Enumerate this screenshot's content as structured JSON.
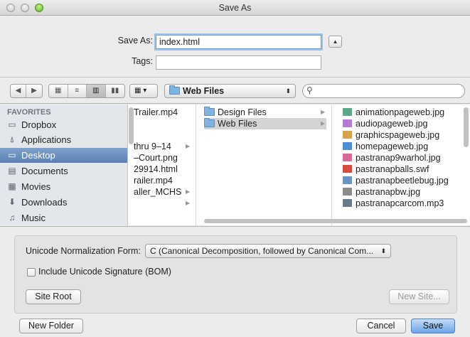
{
  "window": {
    "title": "Save As"
  },
  "form": {
    "save_as_label": "Save As:",
    "save_as_value": "index.html",
    "tags_label": "Tags:",
    "tags_value": ""
  },
  "toolbar": {
    "location": "Web Files"
  },
  "sidebar": {
    "heading": "FAVORITES",
    "items": [
      {
        "label": "Dropbox",
        "icon": "folder-icon"
      },
      {
        "label": "Applications",
        "icon": "applications-icon"
      },
      {
        "label": "Desktop",
        "icon": "desktop-icon",
        "selected": true
      },
      {
        "label": "Documents",
        "icon": "documents-icon"
      },
      {
        "label": "Movies",
        "icon": "movies-icon"
      },
      {
        "label": "Downloads",
        "icon": "downloads-icon"
      },
      {
        "label": "Music",
        "icon": "music-icon"
      }
    ]
  },
  "column1": {
    "items": [
      "Trailer.mp4",
      "",
      "",
      "thru 9–14",
      "–Court.png",
      "29914.html",
      "railer.mp4",
      "aller_MCHS",
      ""
    ]
  },
  "column2": {
    "items": [
      "Design Files",
      "Web Files"
    ]
  },
  "column3": {
    "items": [
      {
        "name": "animationpageweb.jpg",
        "color": "#5aa98a"
      },
      {
        "name": "audiopageweb.jpg",
        "color": "#b57ad8"
      },
      {
        "name": "graphicspageweb.jpg",
        "color": "#d9a24a"
      },
      {
        "name": "homepageweb.jpg",
        "color": "#4a8fd8"
      },
      {
        "name": "pastranap9warhol.jpg",
        "color": "#d86a9a"
      },
      {
        "name": "pastranapballs.swf",
        "color": "#d84a3a"
      },
      {
        "name": "pastranapbeetlebug.jpg",
        "color": "#6a94c8"
      },
      {
        "name": "pastranapbw.jpg",
        "color": "#8a8a8a"
      },
      {
        "name": "pastranapcarcom.mp3",
        "color": "#6a7a8a"
      }
    ]
  },
  "options": {
    "normalization_label": "Unicode Normalization Form:",
    "normalization_value": "C (Canonical Decomposition, followed by Canonical Com...",
    "bom_label": "Include Unicode Signature (BOM)",
    "site_root": "Site Root",
    "new_site": "New Site..."
  },
  "footer": {
    "new_folder": "New Folder",
    "cancel": "Cancel",
    "save": "Save"
  }
}
